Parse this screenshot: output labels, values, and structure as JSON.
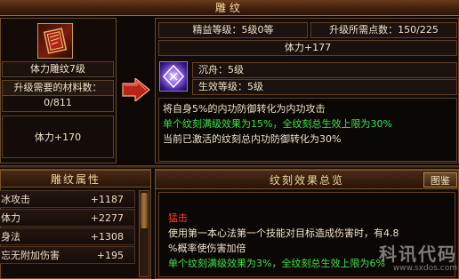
{
  "window": {
    "title": "雕纹"
  },
  "left_top": {
    "item_name": "体力雕纹7级",
    "material_label": "升级需要的材料数：",
    "material_value": "0/811",
    "stat_text": "体力+170"
  },
  "right_top": {
    "refine_level": "精益等级：5级0等",
    "upgrade_points": "升级所需点数：150/225",
    "stat_total": "体力+177",
    "skill_name": "沉舟：5级",
    "effect_level": "生效等级：5级",
    "desc_line1": "将自身5%的内功防御转化为内功攻击",
    "desc_line2": "单个纹刻满级效果为15%，全纹刻总生效上限为30%",
    "desc_line3": "当前已激活的纹刻总内功防御转化为30%"
  },
  "attributes": {
    "header": "雕纹属性",
    "rows": [
      {
        "name": "冰攻击",
        "value": "+1187"
      },
      {
        "name": "体力",
        "value": "+2277"
      },
      {
        "name": "身法",
        "value": "+1308"
      },
      {
        "name": "忘无附加伤害",
        "value": "+195"
      }
    ]
  },
  "overview": {
    "header": "纹刻效果总览",
    "button_label": "图鉴",
    "effect_title": "猛击",
    "effect_line1": "使用第一本心法第一个技能对目标造成伤害时，有4.8",
    "effect_line2": "%概率使伤害加倍",
    "effect_line3": "单个纹刻满级效果为3%，全纹刻总生效上限为6%"
  },
  "watermark": {
    "text": "科讯代码",
    "sub": "www.sxdos.com"
  },
  "colors": {
    "accent_green": "#3ee04a",
    "accent_red": "#ff3a2a",
    "gold_text": "#f5dfa6"
  }
}
